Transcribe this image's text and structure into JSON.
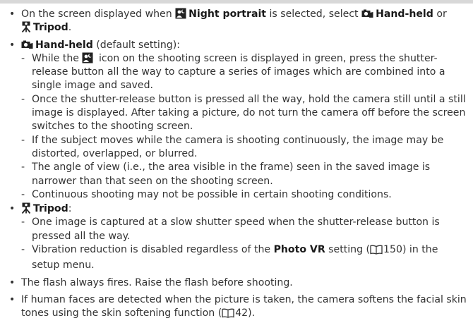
{
  "intro": {
    "text_1": "On the screen displayed when ",
    "night_portrait": "Night portrait",
    "text_2": " is selected, select ",
    "hand_held": "Hand-held",
    "text_3": " or",
    "tripod": "Tripod",
    "text_4": "."
  },
  "hand_held_section": {
    "title": "Hand-held",
    "suffix": " (default setting):",
    "items": [
      {
        "part_1": "While the ",
        "part_2": " icon on the shooting screen is displayed in green, press the shutter-release button all the way to capture a series of images which are combined into a single image and saved."
      },
      {
        "text": "Once the shutter-release button is pressed all the way, hold the camera still until a still image is displayed. After taking a picture, do not turn the camera off before the screen switches to the shooting screen."
      },
      {
        "text": "If the subject moves while the camera is shooting continuously, the image may be distorted, overlapped, or blurred."
      },
      {
        "text": "The angle of view (i.e., the area visible in the frame) seen in the saved image is narrower than that seen on the shooting screen."
      },
      {
        "text": "Continuous shooting may not be possible in certain shooting conditions."
      }
    ]
  },
  "tripod_section": {
    "title": "Tripod",
    "suffix": ":",
    "item_1": "One image is captured at a slow shutter speed when the shutter-release button is pressed all the way.",
    "item_2_part_1": "Vibration reduction is disabled regardless of the ",
    "item_2_bold": "Photo VR",
    "item_2_part_2": " setting (",
    "item_2_page": "150",
    "item_2_part_3": ") in the setup menu."
  },
  "flash_note": "The flash always fires. Raise the flash before shooting.",
  "faces_note": {
    "part_1": "If human faces are detected when the picture is taken, the camera softens the facial skin tones using the skin softening function (",
    "page": "42",
    "part_2": ")."
  },
  "icons": {
    "night_portrait_icon": "night-portrait-icon",
    "hand_held_icon": "hand-held-icon",
    "tripod_icon": "tripod-icon",
    "reference_icon": "book-reference-icon"
  },
  "colors": {
    "text": "#333333",
    "bold_text": "#1a1a1a",
    "top_band": "#d8d8d8"
  }
}
